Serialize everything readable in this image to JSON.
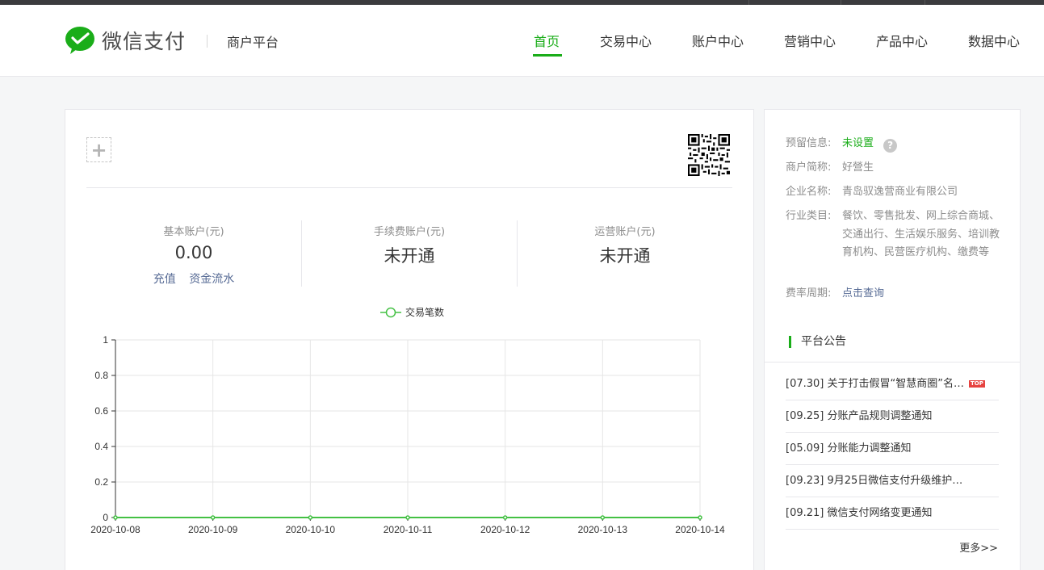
{
  "header": {
    "logo_text": "微信支付",
    "platform": "商户平台",
    "nav": [
      {
        "label": "首页",
        "active": true
      },
      {
        "label": "交易中心",
        "active": false
      },
      {
        "label": "账户中心",
        "active": false
      },
      {
        "label": "营销中心",
        "active": false
      },
      {
        "label": "产品中心",
        "active": false
      },
      {
        "label": "数据中心",
        "active": false
      }
    ]
  },
  "accounts": [
    {
      "label": "基本账户(元)",
      "value": "0.00",
      "links": [
        "充值",
        "资金流水"
      ]
    },
    {
      "label": "手续费账户(元)",
      "value": "未开通"
    },
    {
      "label": "运营账户(元)",
      "value": "未开通"
    }
  ],
  "chart_data": {
    "type": "line",
    "title": "",
    "xlabel": "",
    "ylabel": "",
    "x": [
      "2020-10-08",
      "2020-10-09",
      "2020-10-10",
      "2020-10-11",
      "2020-10-12",
      "2020-10-13",
      "2020-10-14"
    ],
    "series": [
      {
        "name": "交易笔数",
        "values": [
          0,
          0,
          0,
          0,
          0,
          0,
          0
        ],
        "color": "#44c144"
      }
    ],
    "y_ticks": [
      "0",
      "0.2",
      "0.4",
      "0.6",
      "0.8",
      "1"
    ],
    "ylim": [
      0,
      1
    ],
    "grid": true,
    "legend": "top-center"
  },
  "merchant_info": {
    "reserved_label": "预留信息:",
    "reserved_value": "未设置",
    "help_icon": "?",
    "short_name_label": "商户简称:",
    "short_name_value": "好營生",
    "company_label": "企业名称:",
    "company_value": "青岛驭逸营商业有限公司",
    "industry_label": "行业类目:",
    "industry_value": "餐饮、零售批发、网上综合商城、交通出行、生活娱乐服务、培训教育机构、民营医疗机构、缴费等",
    "fee_label": "费率周期:",
    "fee_value": "点击查询"
  },
  "notices": {
    "title": "平台公告",
    "items": [
      {
        "text": "[07.30] 关于打击假冒“智慧商圈”名…",
        "badge": "TOP"
      },
      {
        "text": "[09.25] 分账产品规则调整通知"
      },
      {
        "text": "[05.09] 分账能力调整通知"
      },
      {
        "text": "[09.23] 9月25日微信支付升级维护…"
      },
      {
        "text": "[09.21] 微信支付网络变更通知"
      }
    ],
    "more": "更多>>"
  },
  "colors": {
    "accent": "#1aad19",
    "link": "#576b95"
  }
}
